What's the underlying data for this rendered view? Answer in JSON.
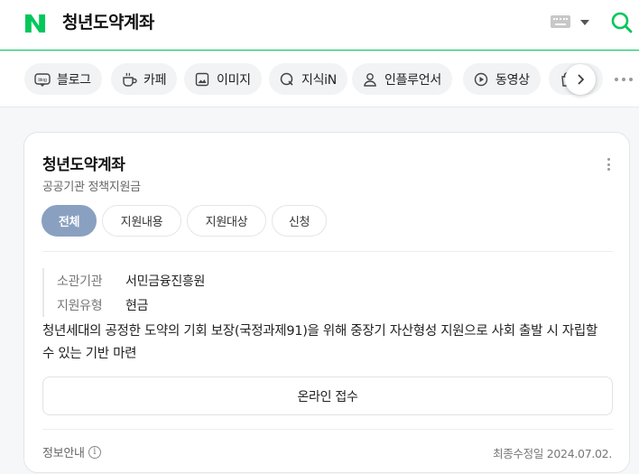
{
  "header": {
    "query": "청년도약계좌",
    "colors": {
      "brand": "#03c75a"
    }
  },
  "tabs": [
    {
      "label": "블로그",
      "icon": "blog-icon"
    },
    {
      "label": "카페",
      "icon": "cafe-cup-icon"
    },
    {
      "label": "이미지",
      "icon": "image-icon"
    },
    {
      "label": "지식iN",
      "icon": "q-icon"
    },
    {
      "label": "인플루언서",
      "icon": "person-icon"
    },
    {
      "label": "동영상",
      "icon": "play-icon"
    },
    {
      "label": "",
      "icon": "shopping-icon"
    }
  ],
  "card": {
    "title": "청년도약계좌",
    "subtitle": "공공기관 정책지원금",
    "segments": [
      {
        "label": "전체",
        "active": true
      },
      {
        "label": "지원내용",
        "active": false
      },
      {
        "label": "지원대상",
        "active": false
      },
      {
        "label": "신청",
        "active": false
      }
    ],
    "info": [
      {
        "key": "소관기관",
        "value": "서민금융진흥원"
      },
      {
        "key": "지원유형",
        "value": "현금"
      }
    ],
    "description": "청년세대의 공정한 도약의 기회 보장(국정과제91)을 위해 중장기 자산형성 지원으로 사회 출발 시 자립할 수 있는 기반 마련",
    "apply_button": "온라인 접수",
    "footer": {
      "info_label": "정보안내",
      "updated": "최종수정일 2024.07.02."
    }
  }
}
